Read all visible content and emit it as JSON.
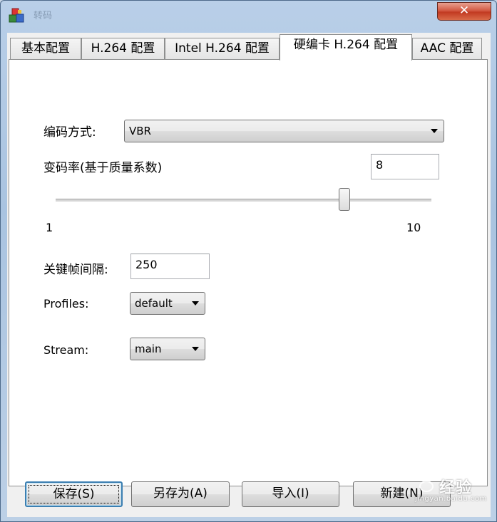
{
  "window": {
    "title": "转码",
    "close_label": "✕"
  },
  "tabs": [
    {
      "label": "基本配置",
      "active": false
    },
    {
      "label": "H.264 配置",
      "active": false
    },
    {
      "label": "Intel H.264 配置",
      "active": false
    },
    {
      "label": "硬编卡 H.264 配置",
      "active": true
    },
    {
      "label": "AAC 配置",
      "active": false
    }
  ],
  "form": {
    "encode_mode_label": "编码方式:",
    "encode_mode_value": "VBR",
    "bitrate_label": "变码率(基于质量系数)",
    "bitrate_value": "8",
    "slider": {
      "min_label": "1",
      "max_label": "10",
      "min": 1,
      "max": 10,
      "value": 8
    },
    "keyframe_label": "关键帧间隔:",
    "keyframe_value": "250",
    "profiles_label": "Profiles:",
    "profiles_value": "default",
    "stream_label": "Stream:",
    "stream_value": "main"
  },
  "buttons": {
    "save": "保存(S)",
    "save_as": "另存为(A)",
    "import": "导入(I)",
    "new": "新建(N)"
  },
  "watermark": {
    "text": "经验",
    "url": "jingyan.baidu.com"
  }
}
